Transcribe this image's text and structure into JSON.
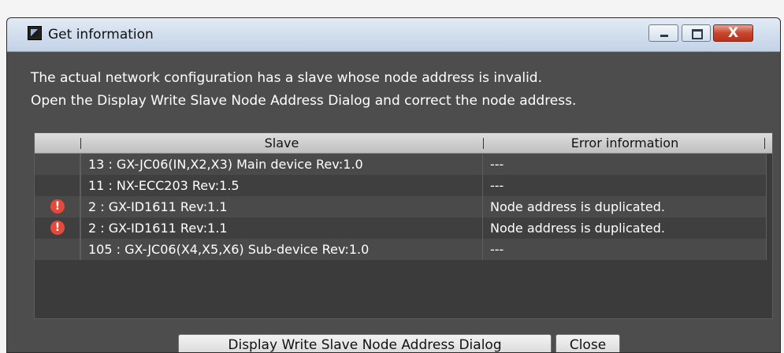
{
  "window": {
    "title": "Get information",
    "close_glyph": "X"
  },
  "message": {
    "line1": "The actual network configuration has a slave whose node address is invalid.",
    "line2": "Open the Display Write Slave Node Address Dialog and correct the node address."
  },
  "table": {
    "headers": {
      "slave": "Slave",
      "error": "Error information"
    },
    "rows": [
      {
        "status_icon": "",
        "slave": "13 : GX-JC06(IN,X2,X3) Main device Rev:1.0",
        "error": "---"
      },
      {
        "status_icon": "",
        "slave": "11 : NX-ECC203 Rev:1.5",
        "error": "---"
      },
      {
        "status_icon": "!",
        "slave": "2 : GX-ID1611 Rev:1.1",
        "error": "Node address is duplicated."
      },
      {
        "status_icon": "!",
        "slave": "2 : GX-ID1611 Rev:1.1",
        "error": "Node address is duplicated."
      },
      {
        "status_icon": "",
        "slave": "105 : GX-JC06(X4,X5,X6) Sub-device Rev:1.0",
        "error": "---"
      }
    ]
  },
  "buttons": {
    "display": "Display Write Slave Node Address Dialog",
    "close": "Close"
  },
  "colors": {
    "error": "#e34a3a",
    "dialog_bg": "#4d4d4d",
    "titlebar": "#d2dfee"
  }
}
